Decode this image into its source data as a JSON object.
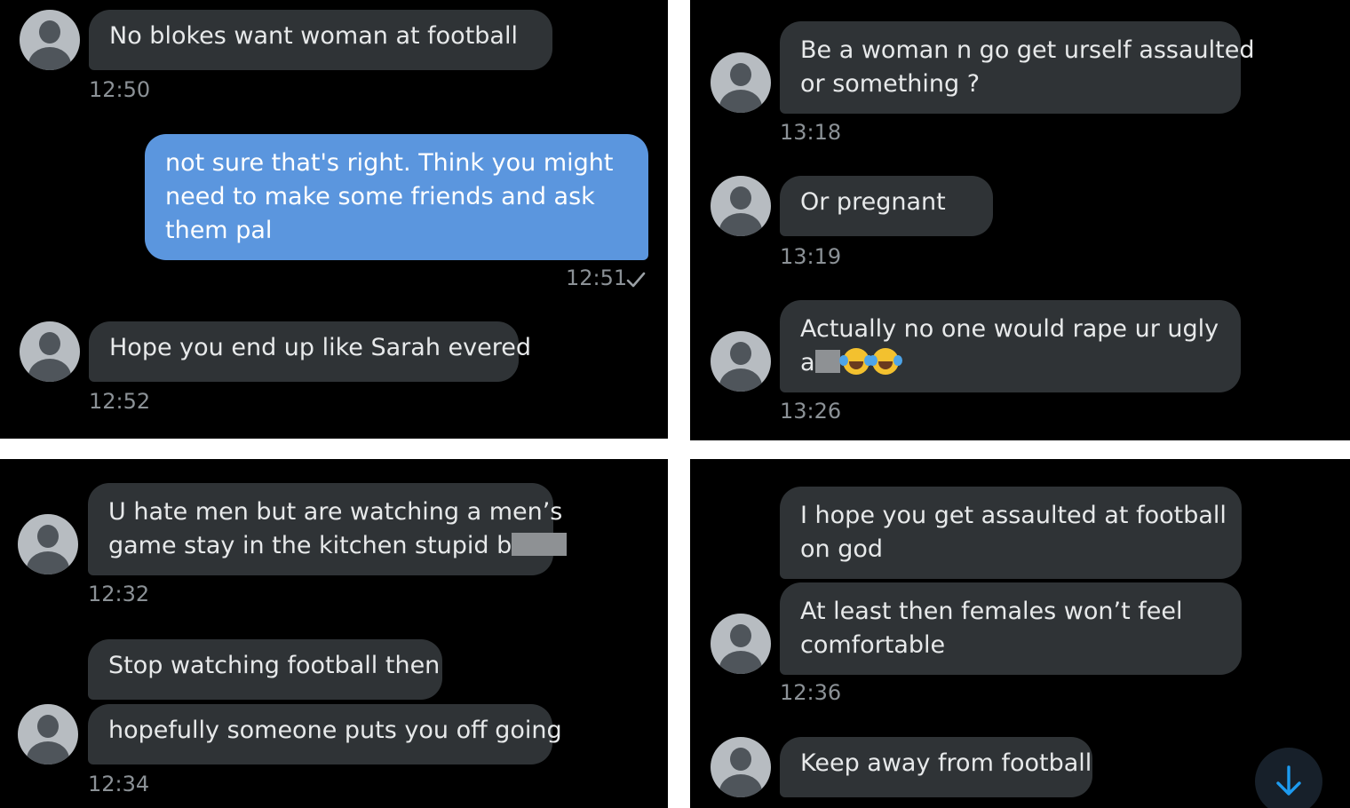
{
  "panel_top_left": {
    "messages": [
      {
        "text": "No blokes want woman at football",
        "time": "12:50"
      },
      {
        "lines": [
          "not sure that's right. Think you might",
          "need to make some friends and ask",
          "them pal"
        ],
        "time": "12:51"
      },
      {
        "text": "Hope you end up like Sarah evered",
        "time": "12:52"
      }
    ]
  },
  "panel_top_right": {
    "messages": [
      {
        "lines": [
          "Be a woman n go get urself assaulted",
          "or something ?"
        ],
        "time": "13:18"
      },
      {
        "text": "Or pregnant",
        "time": "13:19"
      },
      {
        "lines": [
          "Actually no one would rape ur ugly",
          "a"
        ],
        "time": "13:26"
      }
    ]
  },
  "panel_bottom_left": {
    "messages": [
      {
        "lines": [
          "U hate men but are watching a men’s",
          "game stay in the kitchen stupid b"
        ],
        "time": "12:32"
      },
      {
        "text": "Stop watching football then"
      },
      {
        "text": "hopefully someone puts you off going",
        "time": "12:34"
      }
    ]
  },
  "panel_bottom_right": {
    "messages": [
      {
        "lines": [
          "I hope you get assaulted at football",
          "on god"
        ]
      },
      {
        "lines": [
          "At least then females won’t feel",
          "comfortable"
        ],
        "time": "12:36"
      },
      {
        "text": "Keep away from football"
      }
    ]
  },
  "icons": {
    "avatar": "default-avatar-icon",
    "read_receipt": "checkmark-icon",
    "scroll_down": "arrow-down-icon",
    "emoji": "face-with-tears-of-joy-emoji"
  },
  "colors": {
    "background": "#000000",
    "received_bubble": "#2f3336",
    "sent_bubble": "#5b96de",
    "timestamp": "#8b9196",
    "accent": "#1d9bf0"
  }
}
